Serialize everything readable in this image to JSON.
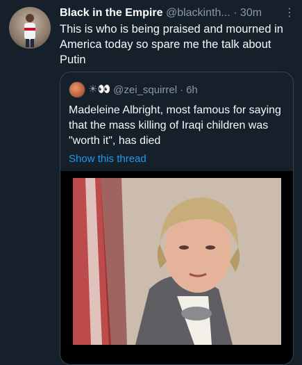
{
  "tweet": {
    "author_name": "Black in the Empire",
    "author_handle": "@blackinth...",
    "separator": "·",
    "time": "30m",
    "more_icon": "⋮",
    "text": "This is who is being praised and mourned in America today so spare me the talk about Putin"
  },
  "quoted": {
    "emoji": "☀👀",
    "handle": "@zei_squirrel",
    "separator": "·",
    "time": "6h",
    "text": "Madeleine Albright, most famous for saying that the mass killing of Iraqi children was \"worth it\", has died",
    "show_thread": "Show this thread"
  }
}
